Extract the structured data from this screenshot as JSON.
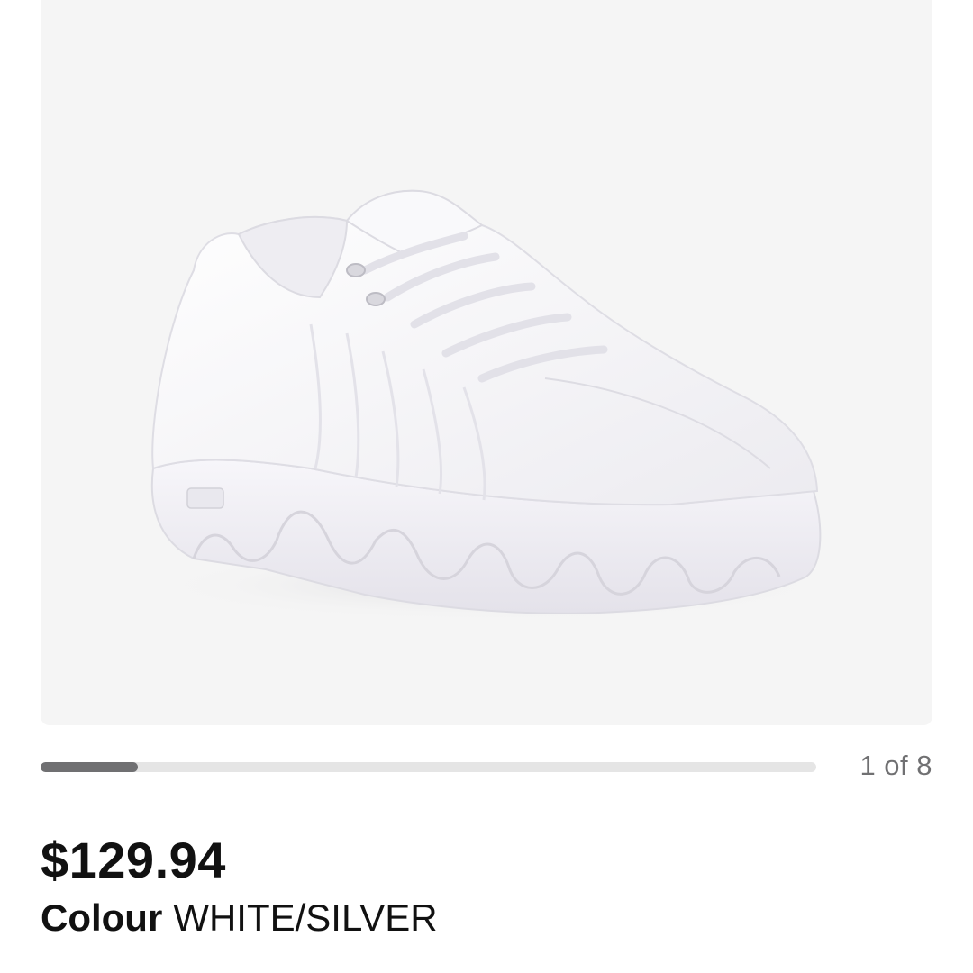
{
  "product": {
    "image_alt": "White leather low-top sneaker",
    "price": "$129.94",
    "colour_label": "Colour",
    "colour_value": "WHITE/SILVER"
  },
  "carousel": {
    "counter": "1 of 8",
    "progress_fraction": 0.125
  },
  "colors": {
    "image_background": "#f5f5f5",
    "track": "#e5e5e5",
    "track_fill": "#707072",
    "text_primary": "#111111",
    "text_secondary": "#707072"
  }
}
